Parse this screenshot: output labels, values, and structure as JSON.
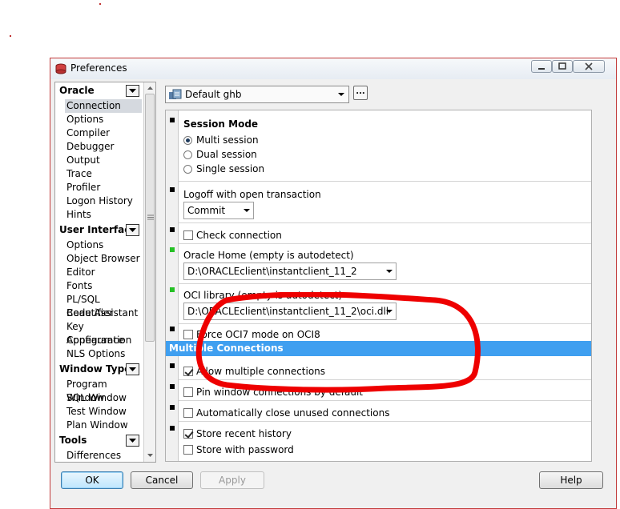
{
  "window": {
    "title": "Preferences"
  },
  "nav": {
    "groups": [
      {
        "label": "Oracle",
        "items": [
          "Connection",
          "Options",
          "Compiler",
          "Debugger",
          "Output",
          "Trace",
          "Profiler",
          "Logon History",
          "Hints"
        ]
      },
      {
        "label": "User Interface",
        "items": [
          "Options",
          "Object Browser",
          "Editor",
          "Fonts",
          "PL/SQL Beautifier",
          "Code Assistant",
          "Key Configuration",
          "Appearance",
          "NLS Options"
        ]
      },
      {
        "label": "Window Types",
        "items": [
          "Program Window",
          "SQL Window",
          "Test Window",
          "Plan Window"
        ]
      },
      {
        "label": "Tools",
        "items": [
          "Differences"
        ]
      }
    ],
    "selected": "Connection"
  },
  "profile": {
    "value": "Default ghb",
    "ellipsis": "..."
  },
  "settings": {
    "session_mode": {
      "label": "Session Mode",
      "options": [
        "Multi session",
        "Dual session",
        "Single session"
      ],
      "selected": "Multi session"
    },
    "logoff": {
      "label": "Logoff with open transaction",
      "value": "Commit"
    },
    "check_connection": {
      "label": "Check connection",
      "checked": false
    },
    "oracle_home": {
      "label": "Oracle Home (empty is autodetect)",
      "value": "D:\\ORACLEclient\\instantclient_11_2"
    },
    "oci_library": {
      "label": "OCI library (empty is autodetect)",
      "value": "D:\\ORACLEclient\\instantclient_11_2\\oci.dll"
    },
    "force_oci7": {
      "label": "Force OCI7 mode on OCI8",
      "checked": false
    },
    "multiple_connections_header": "Multiple Connections",
    "allow_multiple": {
      "label": "Allow multiple connections",
      "checked": true
    },
    "pin_window": {
      "label": "Pin window connections by default",
      "checked": false
    },
    "auto_close": {
      "label": "Automatically close unused connections",
      "checked": false
    },
    "store_history": {
      "label": "Store recent history",
      "checked": true
    },
    "store_password": {
      "label": "Store with password",
      "checked": false
    }
  },
  "buttons": {
    "ok": "OK",
    "cancel": "Cancel",
    "apply": "Apply",
    "help": "Help"
  },
  "colors": {
    "selection_header": "#3f9ff0",
    "annotation": "#ee0000",
    "changed_marker": "#25c025"
  }
}
